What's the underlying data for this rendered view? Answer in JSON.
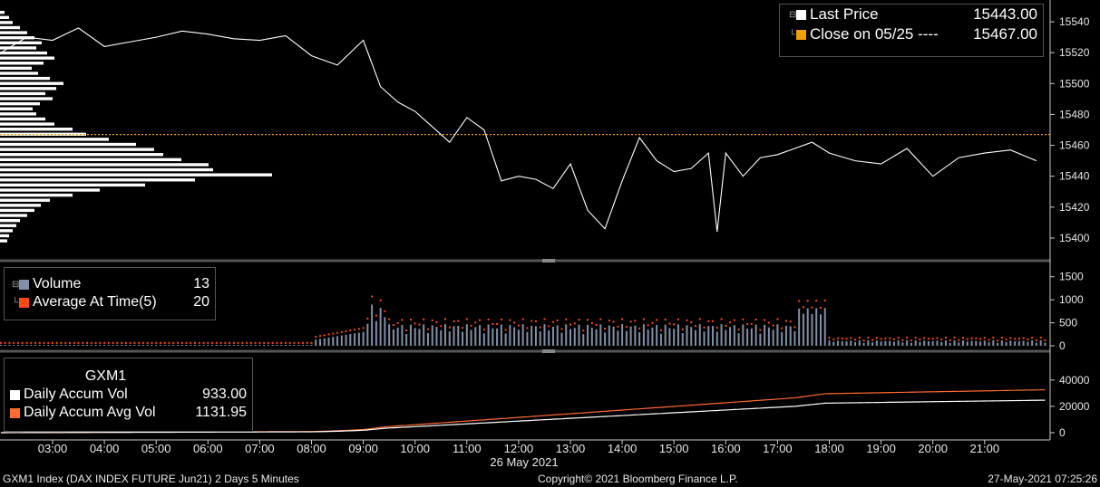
{
  "colors": {
    "price_line": "#ffffff",
    "close_line": "#f0a000",
    "volume_bar": "#8090a8",
    "avg_dot": "#ff4a10",
    "accum_vol": "#ffffff",
    "accum_avg": "#ff6a30"
  },
  "legend_price": {
    "last_label": "Last Price",
    "last_value": "15443.00",
    "close_label": "Close on 05/25 ----",
    "close_value": "15467.00"
  },
  "legend_volume": {
    "vol_label": "Volume",
    "vol_value": "13",
    "avg_label": "Average At Time(5)",
    "avg_value": "20"
  },
  "legend_accum": {
    "title": "GXM1",
    "accum_label": "Daily Accum Vol",
    "accum_value": "933.00",
    "avg_label": "Daily Accum Avg Vol",
    "avg_value": "1131.95"
  },
  "x_date_label": "26 May 2021",
  "footer": {
    "left": "GXM1 Index (DAX INDEX FUTURE  Jun21) 2 Days 5 Minutes",
    "center": "Copyright© 2021 Bloomberg Finance L.P.",
    "right": "27-May-2021 07:25:26"
  },
  "chart_data": [
    {
      "type": "line",
      "ylim": [
        15390,
        15550
      ],
      "yticks": [
        "15540",
        "15520",
        "15500",
        "15480",
        "15460",
        "15440",
        "15420",
        "15400"
      ],
      "x_times": [
        "02:00",
        "02:30",
        "03:00",
        "03:30",
        "04:00",
        "04:30",
        "05:00",
        "05:30",
        "06:00",
        "06:30",
        "07:00",
        "07:30",
        "08:00",
        "08:30",
        "09:00",
        "09:20",
        "09:40",
        "10:00",
        "10:20",
        "10:40",
        "11:00",
        "11:20",
        "11:40",
        "12:00",
        "12:20",
        "12:40",
        "13:00",
        "13:20",
        "13:40",
        "14:00",
        "14:20",
        "14:40",
        "15:00",
        "15:20",
        "15:40",
        "15:50",
        "16:00",
        "16:20",
        "16:40",
        "17:00",
        "17:20",
        "17:40",
        "18:00",
        "18:30",
        "19:00",
        "19:30",
        "20:00",
        "20:30",
        "21:00",
        "21:30",
        "22:00"
      ],
      "series": [
        {
          "name": "Last Price",
          "values": [
            15520,
            15530,
            15528,
            15536,
            15524,
            15527,
            15530,
            15534,
            15532,
            15529,
            15528,
            15531,
            15518,
            15512,
            15528,
            15498,
            15488,
            15482,
            15472,
            15462,
            15478,
            15470,
            15437,
            15440,
            15438,
            15432,
            15448,
            15418,
            15406,
            15437,
            15465,
            15450,
            15443,
            15445,
            15455,
            15404,
            15455,
            15440,
            15452,
            15454,
            15458,
            15462,
            15455,
            15450,
            15448,
            15458,
            15440,
            15452,
            15455,
            15457,
            15450
          ]
        },
        {
          "name": "Close on 05/25",
          "values": [
            15467
          ]
        }
      ],
      "volume_profile": [
        5,
        10,
        14,
        22,
        30,
        38,
        46,
        40,
        52,
        60,
        48,
        35,
        42,
        55,
        70,
        62,
        50,
        58,
        44,
        36,
        40,
        50,
        60,
        80,
        95,
        120,
        150,
        170,
        180,
        200,
        230,
        235,
        300,
        215,
        160,
        110,
        80,
        55,
        45,
        38,
        30,
        22,
        18,
        14,
        10,
        8
      ]
    },
    {
      "type": "bar",
      "ylim": [
        0,
        1750
      ],
      "yticks": [
        "1500",
        "1000",
        "500",
        "0"
      ],
      "series": [
        {
          "name": "Volume"
        },
        {
          "name": "Average At Time(5)"
        }
      ]
    },
    {
      "type": "line",
      "ylim": [
        0,
        55000
      ],
      "yticks": [
        "40000",
        "20000",
        "0"
      ],
      "series": [
        {
          "name": "Daily Accum Vol"
        },
        {
          "name": "Daily Accum Avg Vol"
        }
      ]
    }
  ],
  "x_ticks": [
    "03:00",
    "04:00",
    "05:00",
    "06:00",
    "07:00",
    "08:00",
    "09:00",
    "10:00",
    "11:00",
    "12:00",
    "13:00",
    "14:00",
    "15:00",
    "16:00",
    "17:00",
    "18:00",
    "19:00",
    "20:00",
    "21:00"
  ]
}
